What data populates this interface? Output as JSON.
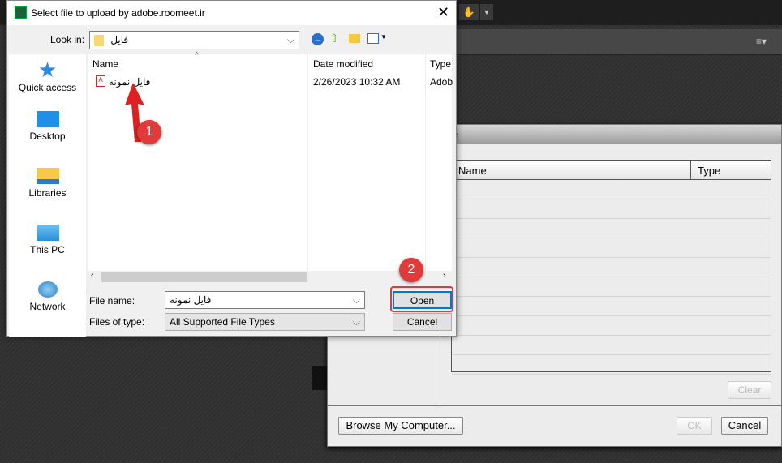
{
  "background": {
    "dialog_title_fragment": "re",
    "table_headers": [
      "Name",
      "Type"
    ],
    "clear_label": "Clear",
    "browse_label": "Browse My Computer...",
    "ok_label": "OK",
    "cancel_label": "Cancel"
  },
  "dialog": {
    "title": "Select file to upload by adobe.roomeet.ir",
    "look_in_label": "Look in:",
    "look_in_value": "فایل",
    "nav": [
      {
        "label": "Quick access",
        "icon": "star-icon"
      },
      {
        "label": "Desktop",
        "icon": "desktop-icon"
      },
      {
        "label": "Libraries",
        "icon": "libraries-icon"
      },
      {
        "label": "This PC",
        "icon": "computer-icon"
      },
      {
        "label": "Network",
        "icon": "network-icon"
      }
    ],
    "columns": [
      "Name",
      "Date modified",
      "Type"
    ],
    "files": [
      {
        "name": "فایل نمونه",
        "date": "2/26/2023 10:32 AM",
        "type": "Adob"
      }
    ],
    "file_name_label": "File name:",
    "file_name_value": "فایل نمونه",
    "files_of_type_label": "Files of type:",
    "files_of_type_value": "All Supported File Types",
    "open_label": "Open",
    "cancel_label": "Cancel"
  },
  "annotations": [
    "1",
    "2"
  ],
  "colors": {
    "annotation": "#e03a3a",
    "focus": "#0078d7"
  }
}
